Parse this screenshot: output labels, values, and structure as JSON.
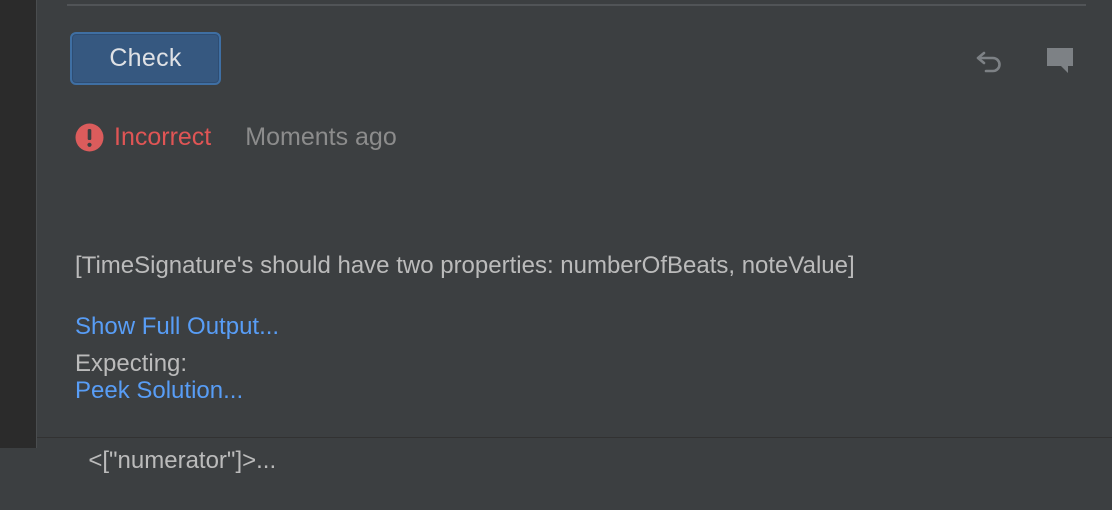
{
  "toolbar": {
    "check_label": "Check"
  },
  "status": {
    "label": "Incorrect",
    "time": "Moments ago",
    "color": "#e05555"
  },
  "output": {
    "lines": [
      "[TimeSignature's should have two properties: numberOfBeats, noteValue]",
      "Expecting:",
      "  <[\"numerator\"]>..."
    ]
  },
  "links": {
    "show_full_output": "Show Full Output...",
    "peek_solution": "Peek Solution..."
  },
  "icons": {
    "undo": "undo-icon",
    "comment": "comment-icon",
    "error": "error-circle-icon"
  },
  "colors": {
    "accent": "#365880",
    "link": "#589df6",
    "background": "#3c3f41"
  }
}
